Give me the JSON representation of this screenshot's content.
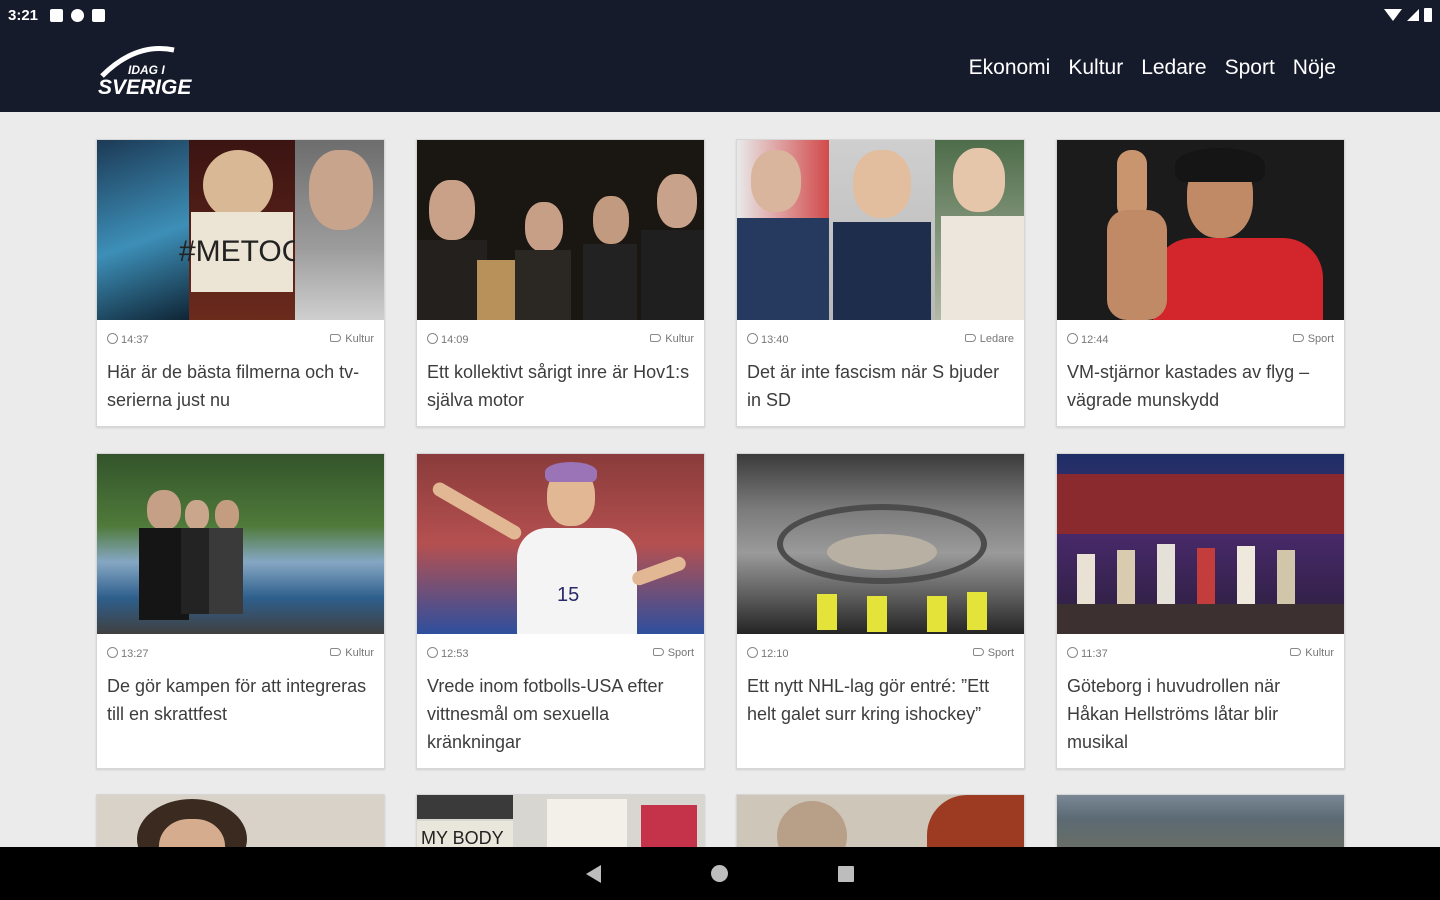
{
  "status": {
    "time": "3:21"
  },
  "header": {
    "logo_top": "IDAG I",
    "logo_main": "SVERIGE",
    "nav": [
      "Ekonomi",
      "Kultur",
      "Ledare",
      "Sport",
      "Nöje"
    ]
  },
  "articles": [
    {
      "time": "14:37",
      "category": "Kultur",
      "title": "Här är de bästa filmerna och tv-serierna just nu",
      "image": "collage-metoo",
      "image_text": "#METOO"
    },
    {
      "time": "14:09",
      "category": "Kultur",
      "title": "Ett kollektivt sårigt inre är Hov1:s själva motor",
      "image": "band-photo"
    },
    {
      "time": "13:40",
      "category": "Ledare",
      "title": "Det är inte fascism när S bjuder in SD",
      "image": "politicians-collage"
    },
    {
      "time": "12:44",
      "category": "Sport",
      "title": "VM-stjärnor kastades av flyg – vägrade munskydd",
      "image": "wrestler"
    },
    {
      "time": "13:27",
      "category": "Kultur",
      "title": "De gör kampen för att integreras till en skrattfest",
      "image": "group-by-lake"
    },
    {
      "time": "12:53",
      "category": "Sport",
      "title": "Vrede inom fotbolls-USA efter vittnesmål om sexuella kränkningar",
      "image": "football-player",
      "image_text": "15"
    },
    {
      "time": "12:10",
      "category": "Sport",
      "title": "Ett nytt NHL-lag gör entré: ”Ett helt galet surr kring ishockey”",
      "image": "arena-construction"
    },
    {
      "time": "11:37",
      "category": "Kultur",
      "title": "Göteborg i huvudrollen när Håkan Hellströms låtar blir musikal",
      "image": "stage-musical"
    },
    {
      "image": "portrait-partial"
    },
    {
      "image": "protest-signs",
      "image_text": "MY BODY"
    },
    {
      "image": "portrait-collage"
    },
    {
      "image": "city-aerial"
    }
  ],
  "colors": {
    "header_bg": "#161b2c",
    "page_bg": "#ebebeb",
    "card_text": "#3d3d3d",
    "meta_text": "#777777"
  }
}
